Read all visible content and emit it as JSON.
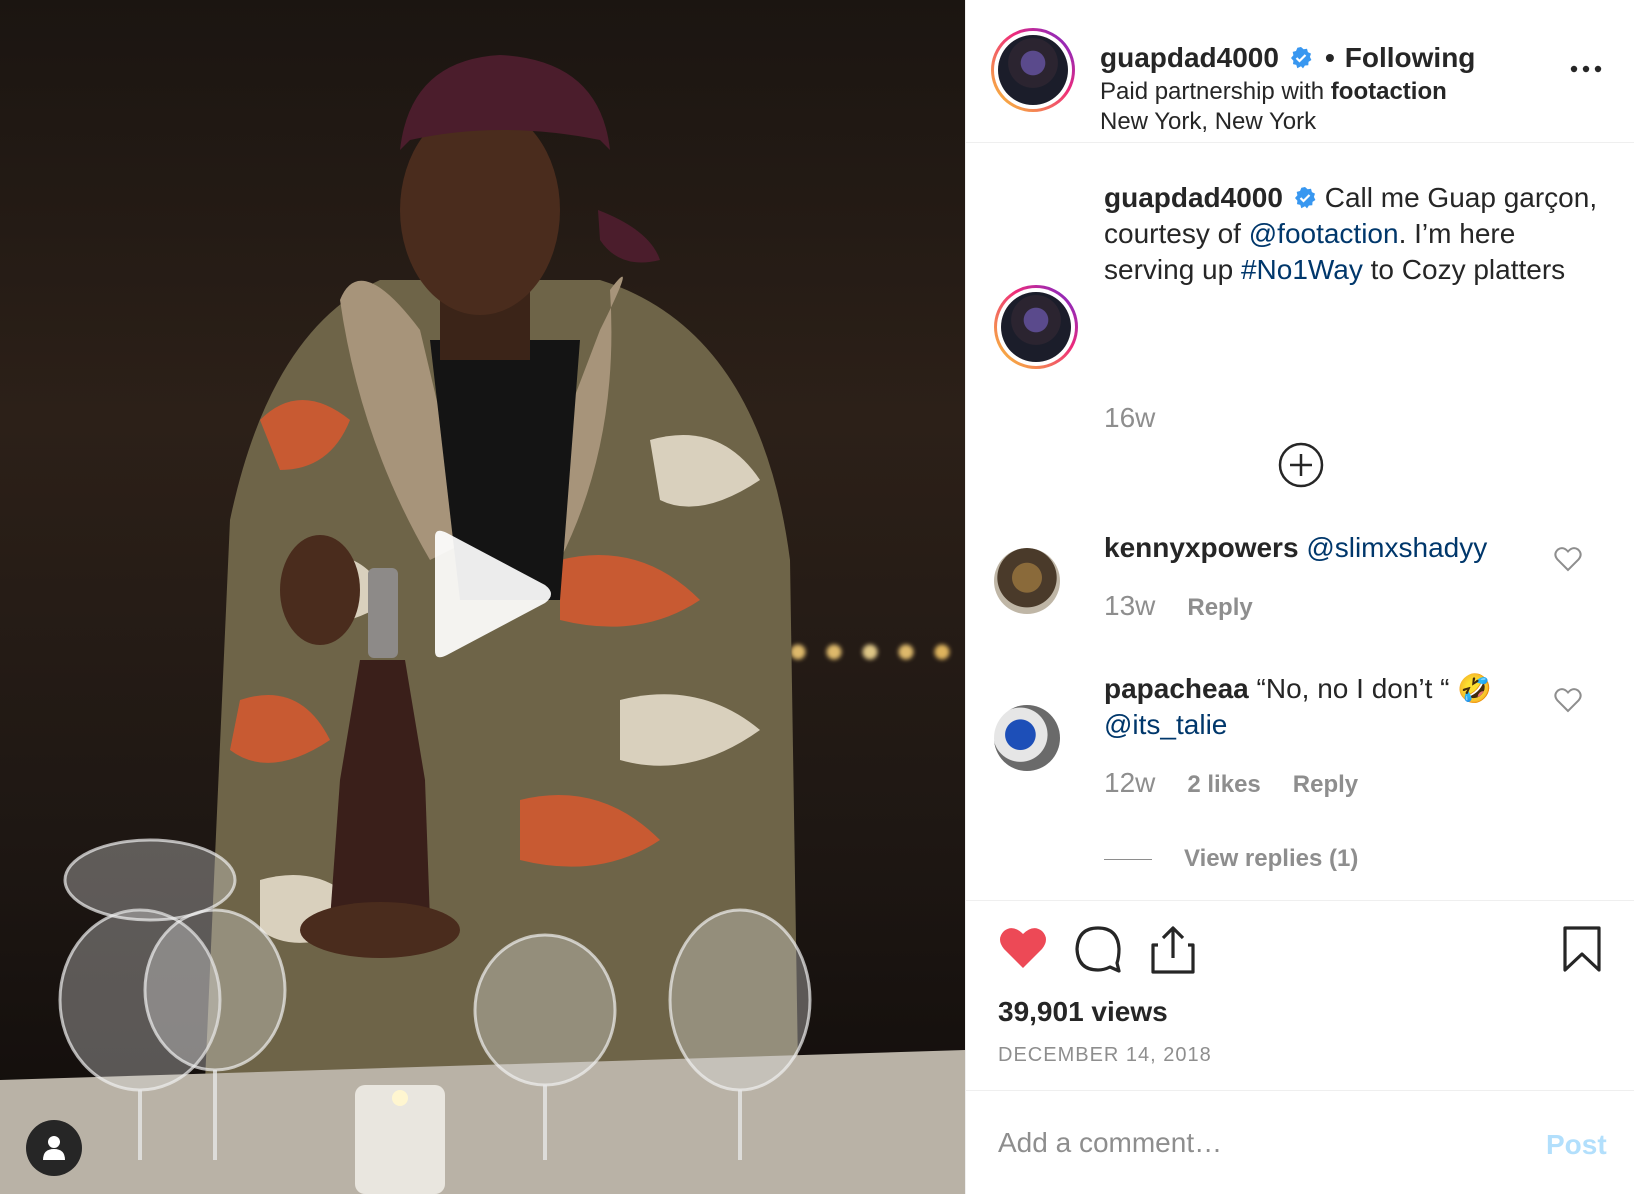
{
  "media": {
    "type": "video",
    "play_icon": "play-icon",
    "user_tag_icon": "user-icon"
  },
  "header": {
    "username": "guapdad4000",
    "verified_icon": "verified-badge-icon",
    "separator": "•",
    "follow_status": "Following",
    "partnership_prefix": "Paid partnership with",
    "partner": "footaction",
    "location": "New York, New York",
    "more_icon": "more-options-icon"
  },
  "caption": {
    "username": "guapdad4000",
    "text_1": "Call me Guap garçon, courtesy of",
    "mention": "@footaction",
    "text_2": ". I’m here serving up",
    "hashtag": "#No1Way",
    "text_3": "to Cozy platters",
    "time": "16w",
    "load_more_icon": "plus-circle-icon"
  },
  "comments": [
    {
      "username": "kennyxpowers",
      "text": "",
      "mention": "@slimxshadyy",
      "time": "13w",
      "likes": "",
      "reply_label": "Reply"
    },
    {
      "username": "papacheaa",
      "text": "“No, no I don’t “ 🤣",
      "mention": "@its_talie",
      "time": "12w",
      "likes": "2 likes",
      "reply_label": "Reply",
      "view_replies": "View replies (1)"
    }
  ],
  "actions": {
    "like_icon": "heart-filled-icon",
    "comment_icon": "comment-icon",
    "share_icon": "share-icon",
    "save_icon": "bookmark-icon",
    "views": "39,901 views",
    "date": "DECEMBER 14, 2018"
  },
  "add_comment": {
    "placeholder": "Add a comment…",
    "post_label": "Post"
  },
  "colors": {
    "link": "#00376b",
    "muted": "#8e8e8e",
    "like": "#ed4956",
    "verified": "#3897f0",
    "post_disabled": "#b2dffc"
  }
}
